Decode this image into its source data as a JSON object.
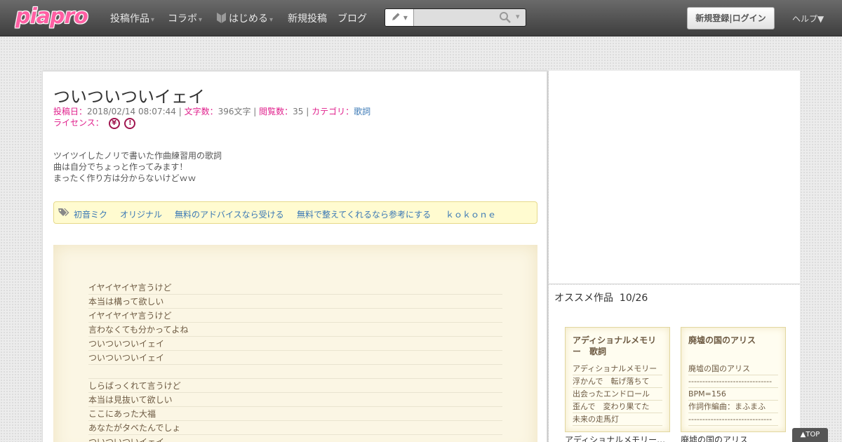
{
  "header": {
    "logo": "piapro",
    "nav": [
      {
        "label": "投稿作品",
        "caret": "▾"
      },
      {
        "label": "コラボ",
        "caret": "▾"
      },
      {
        "label": "はじめる",
        "caret": "▾"
      },
      {
        "label": "新規投稿",
        "caret": ""
      },
      {
        "label": "ブログ",
        "caret": ""
      }
    ],
    "search": {
      "mode_caret": "▾",
      "value": "",
      "placeholder": "",
      "caret": "▾"
    },
    "register_login": "新規登録|ログイン",
    "help": "ヘルプ▼"
  },
  "work": {
    "title": "ついついついイェイ",
    "meta": {
      "posted_label": "投稿日：",
      "posted": "2018/02/14 08:07:44",
      "sep": " | ",
      "chars_label": "文字数：",
      "chars": "396文字",
      "views_label": "閲覧数：",
      "views": "35",
      "category_label": "カテゴリ：",
      "category": "歌詞"
    },
    "license_label": "ライセンス：",
    "license_icons": [
      "¥",
      "!"
    ],
    "description": [
      "ツイツイしたノリで書いた作曲練習用の歌詞",
      "曲は自分でちょっと作ってみます！",
      "まったく作り方は分からないけどｗｗ"
    ],
    "tags": [
      "初音ミク",
      "オリジナル",
      "無料のアドバイスなら受ける",
      "無料で整えてくれるなら参考にする",
      "ｋｏｋｏｎｅ"
    ],
    "lyrics": [
      "イヤイヤイヤ言うけど",
      "本当は構って欲しい",
      "イヤイヤイヤ言うけど",
      "言わなくても分かってよね",
      "ついついついイェイ",
      "ついついついイェイ",
      "",
      "しらばっくれて言うけど",
      "本当は見抜いて欲しい",
      "ここにあった大福",
      "あなたがタベたんでしょ",
      "ついついついイェイ"
    ]
  },
  "sidebar": {
    "recommend_title": "オススメ作品",
    "recommend_page": "10/26",
    "cards": [
      {
        "head": "アディショナルメモリー　歌詞",
        "lines": [
          "アディショナルメモリー",
          "浮かんで　転げ落ちて",
          "出会ったエンドロール",
          "歪んで　変わり果てた",
          "未来の走馬灯"
        ],
        "caption": "アディショナルメモリー　歌詞"
      },
      {
        "head": "廃墟の国のアリス",
        "lines": [
          "廃墟の国のアリス",
          "------------------------------",
          "BPM=156",
          "作詞作編曲：まふまふ",
          "------------------------------"
        ],
        "caption": "廃墟の国のアリス"
      }
    ]
  },
  "top_button": "▲TOP"
}
